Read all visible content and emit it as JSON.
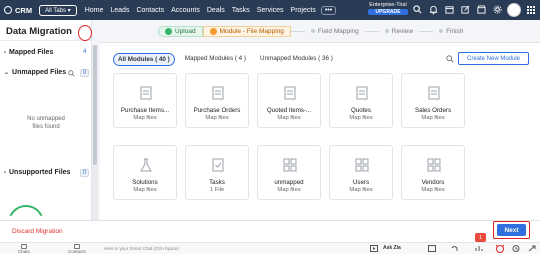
{
  "topnav": {
    "logo_text": "CRM",
    "all_tabs": "All Tabs ▾",
    "items": [
      "Home",
      "Leads",
      "Contacts",
      "Accounts",
      "Deals",
      "Tasks",
      "Services",
      "Projects"
    ],
    "more": "•••",
    "trial_line1": "Enterprise-Trial",
    "trial_upgrade": "UPGRADE",
    "icons": [
      "search-icon",
      "bell-icon",
      "calendar-icon",
      "compose-icon",
      "store-icon",
      "gear-icon"
    ],
    "bg_color": "#2a3b55"
  },
  "left_panel": {
    "title": "Data Migration",
    "mapped_files": {
      "label": "Mapped Files",
      "count": "4"
    },
    "unmapped_files": {
      "label": "Unmapped Files",
      "count": "0"
    },
    "no_unmapped_line1": "No unmapped",
    "no_unmapped_line2": "files found",
    "unsupported_files": {
      "label": "Unsupported Files",
      "count": "0"
    }
  },
  "wizard": {
    "steps": [
      {
        "label": "Upload",
        "state": "done"
      },
      {
        "label": "Module - File Mapping",
        "state": "active"
      },
      {
        "label": "Field Mapping",
        "state": "todo"
      },
      {
        "label": "Review",
        "state": "todo"
      },
      {
        "label": "Finish",
        "state": "todo"
      }
    ]
  },
  "main": {
    "filters": [
      "All Modules ( 40 )",
      "Mapped Modules ( 4 )",
      "Unmapped Modules ( 36 )"
    ],
    "create_button": "Create New Module",
    "cards_row1": [
      {
        "name": "Purchase Items...",
        "sub": "Map files"
      },
      {
        "name": "Purchase Orders",
        "sub": "Map files"
      },
      {
        "name": "Quoted Items-...",
        "sub": "Map files"
      },
      {
        "name": "Quotes",
        "sub": "Map files"
      },
      {
        "name": "Sales Orders",
        "sub": "Map files"
      }
    ],
    "cards_row2": [
      {
        "name": "Solutions",
        "sub": "Map files"
      },
      {
        "name": "Tasks",
        "sub": "1 File"
      },
      {
        "name": "unmapped",
        "sub": "Map files"
      },
      {
        "name": "Users",
        "sub": "Map files"
      },
      {
        "name": "Vendors",
        "sub": "Map files"
      }
    ]
  },
  "footer": {
    "discard": "Discard Migration",
    "next": "Next"
  },
  "bottombar": {
    "chats": "Chats",
    "contacts": "Contacts",
    "smart_chat": "Here is your Smart Chat (Ctrl+Space)",
    "ask_zia": "Ask Zia",
    "badge": "1"
  },
  "colors": {
    "accent": "#2f6fde",
    "highlight_red": "#e02020",
    "success": "#34b36b",
    "active_step": "#f29a2c"
  }
}
